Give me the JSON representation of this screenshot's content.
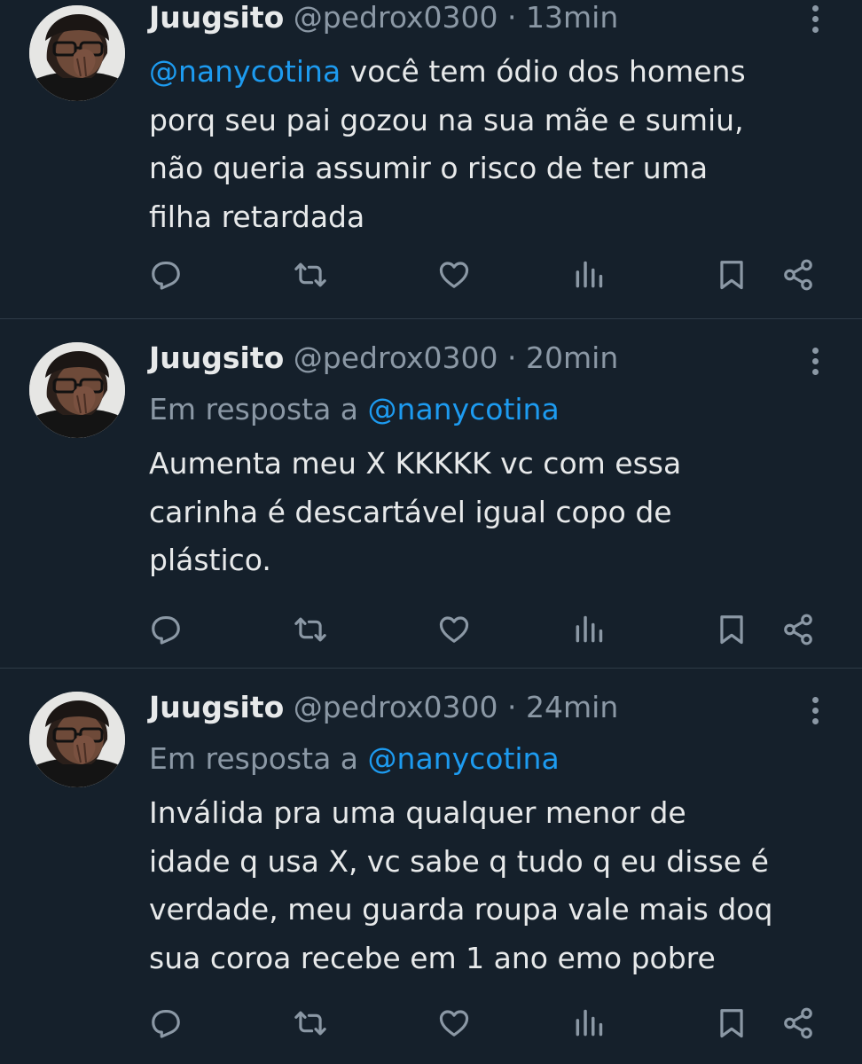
{
  "colors": {
    "background": "#15202b",
    "primary_text": "#e7e9ea",
    "secondary_text": "#8b98a5",
    "mention": "#1d9bf0",
    "divider": "#2f3b47"
  },
  "icons": {
    "reply": "reply-icon",
    "retweet": "retweet-icon",
    "like": "heart-icon",
    "views": "views-chart-icon",
    "bookmark": "bookmark-icon",
    "share": "share-icon",
    "more": "more-dots-icon"
  },
  "tweets": [
    {
      "name": "Juugsito",
      "handle": "@pedrox0300",
      "separator": "·",
      "time": "13min",
      "mention": "@nanycotina",
      "lines": [
        " você tem ódio dos homens",
        "porq seu pai gozou na sua mãe e sumiu,",
        "não queria assumir o risco de ter uma",
        "filha retardada"
      ]
    },
    {
      "name": "Juugsito",
      "handle": "@pedrox0300",
      "separator": "·",
      "time": "20min",
      "reply_prefix": "Em resposta a ",
      "reply_to": "@nanycotina",
      "lines": [
        "Aumenta meu X KKKKK vc com essa",
        "carinha é descartável igual copo de",
        "plástico."
      ]
    },
    {
      "name": "Juugsito",
      "handle": "@pedrox0300",
      "separator": "·",
      "time": "24min",
      "reply_prefix": "Em resposta a ",
      "reply_to": "@nanycotina",
      "lines": [
        "Inválida pra uma qualquer menor de",
        "idade q usa X, vc sabe q tudo q eu disse é",
        "verdade, meu guarda roupa vale mais doq",
        "sua coroa recebe em 1 ano emo pobre"
      ]
    }
  ]
}
